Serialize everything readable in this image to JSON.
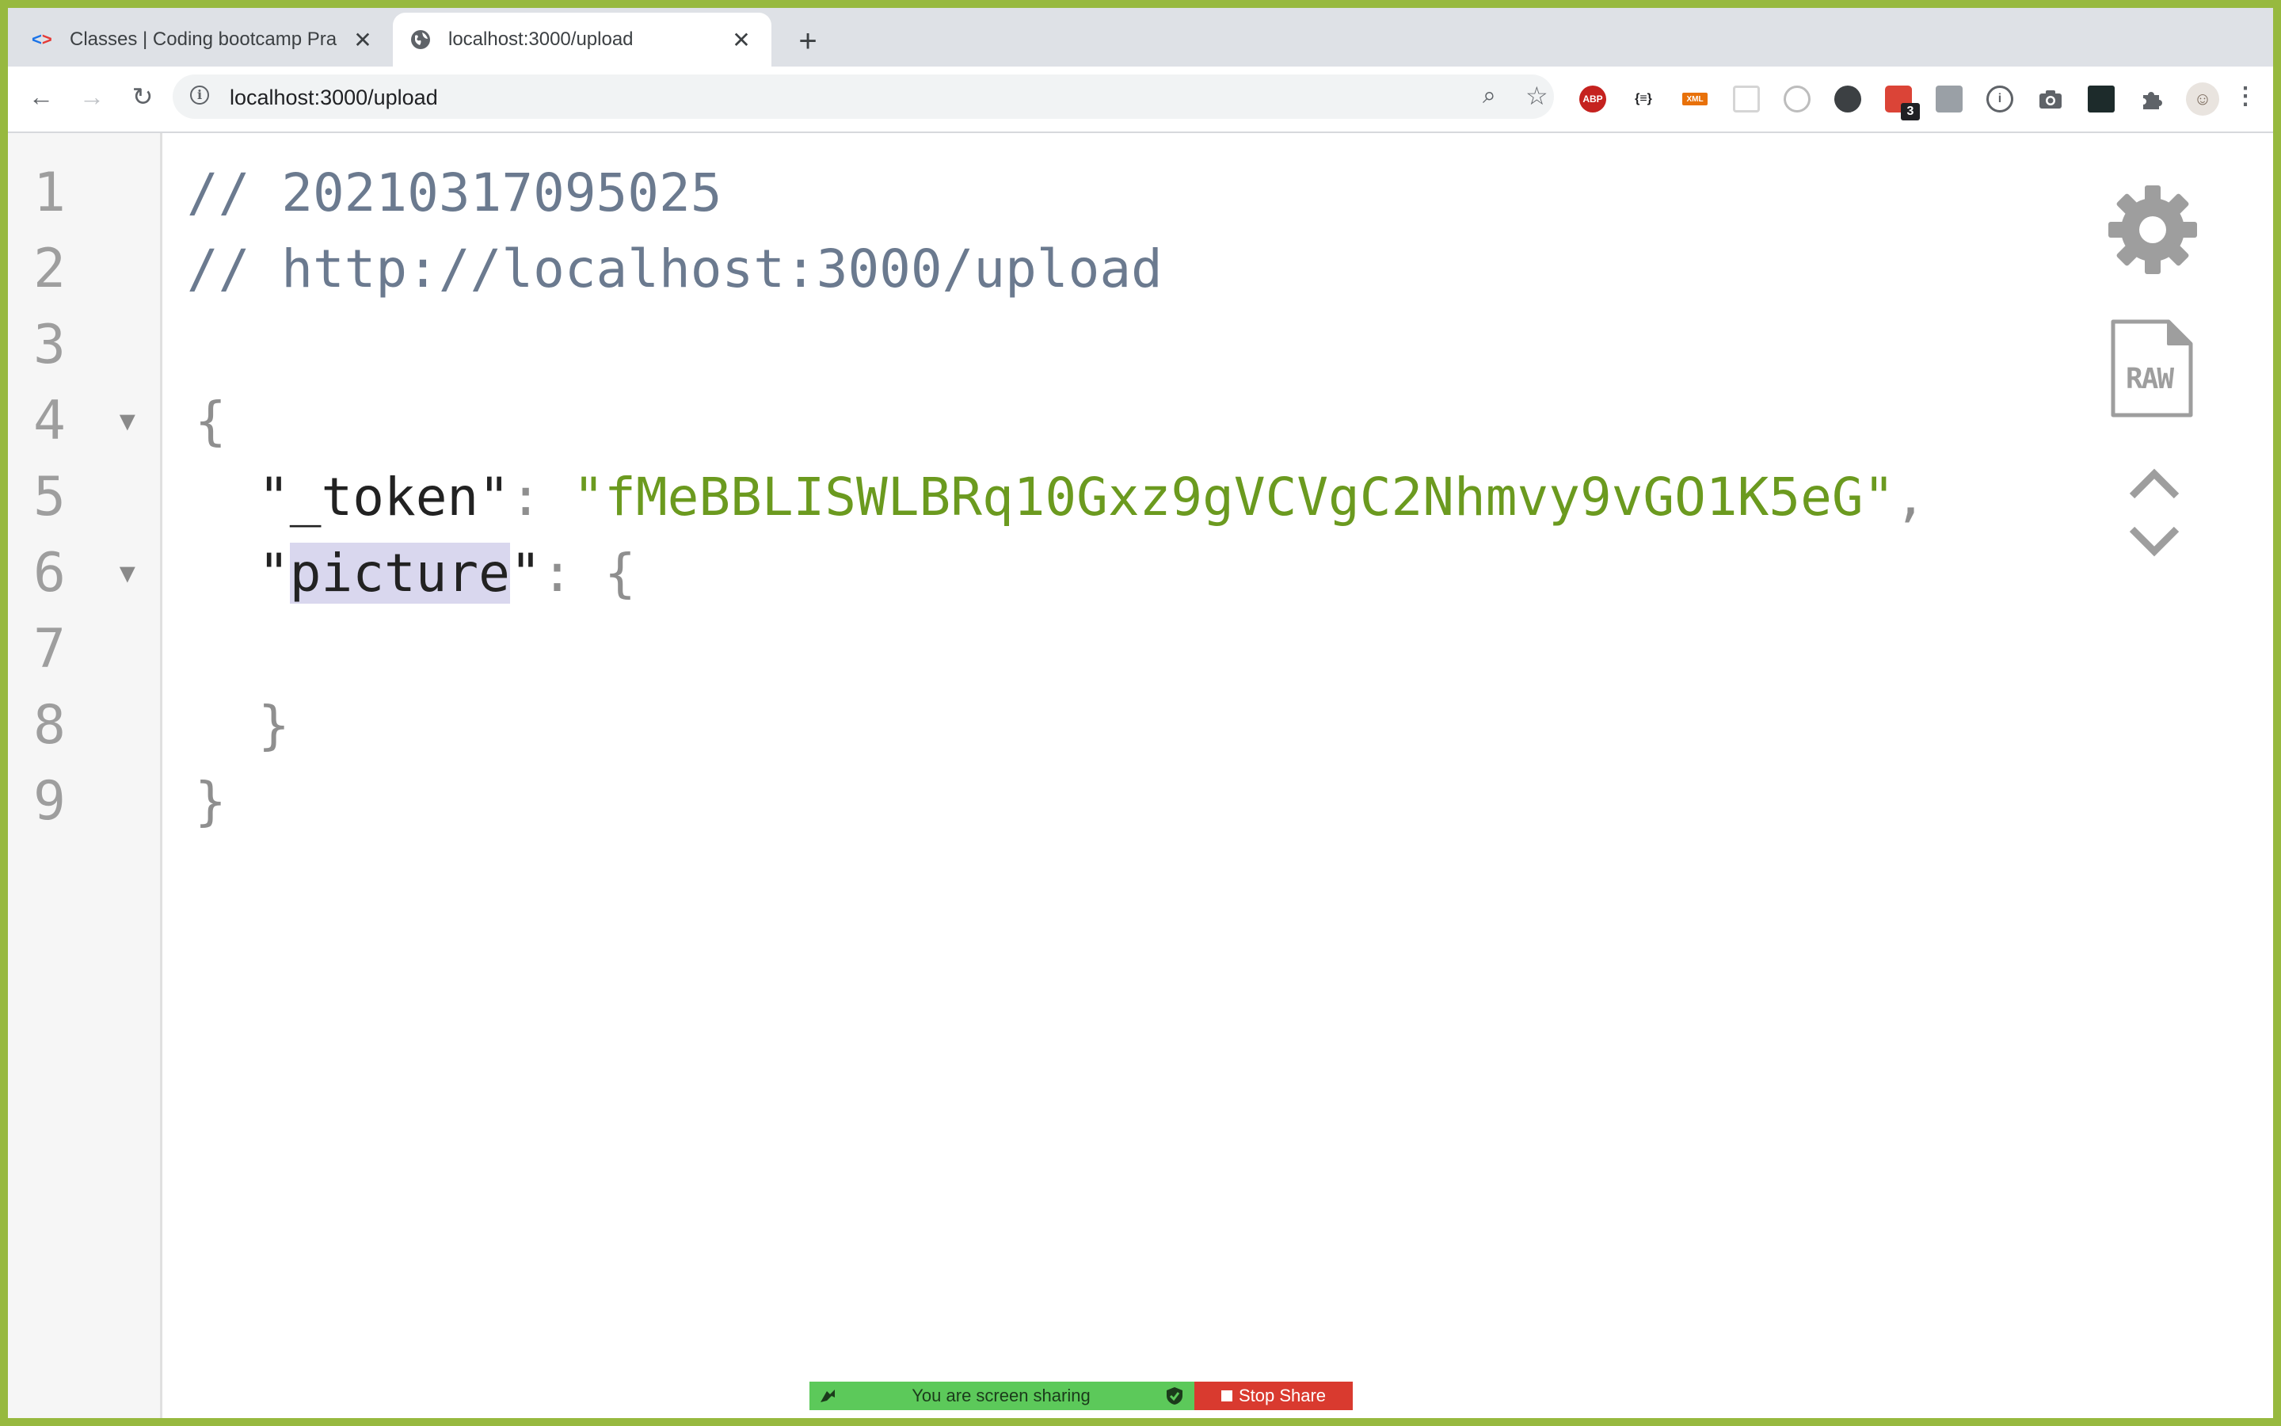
{
  "tabs": [
    {
      "title": "Classes | Coding bootcamp Pra",
      "close": "✕"
    },
    {
      "title": "localhost:3000/upload",
      "close": "✕"
    }
  ],
  "new_tab": "+",
  "toolbar": {
    "back": "←",
    "forward": "→",
    "reload": "↻",
    "url": "localhost:3000/upload",
    "info": "i",
    "zoom": "⌕",
    "star": "☆",
    "extensions": {
      "abp": "ABP",
      "json": "{≡}",
      "xml": "XML",
      "todo_badge": "3",
      "info2": "i",
      "menu": "⋮"
    }
  },
  "viewer": {
    "line_numbers": [
      "1",
      "2",
      "3",
      "4",
      "5",
      "6",
      "7",
      "8",
      "9"
    ],
    "fold_marker": "▼",
    "comment_1": "// 20210317095025",
    "comment_2": "// http://localhost:3000/upload",
    "open_brace": "{",
    "token_key_quote_open": "\"",
    "token_key": "_token",
    "token_key_quote_close": "\"",
    "colon": ": ",
    "token_value": "\"fMeBBLISWLBRq10Gxz9gVCVgC2Nhmvy9vGO1K5eG\"",
    "comma": ",",
    "picture_quote_open": "\"",
    "picture_key": "picture",
    "picture_quote_close": "\"",
    "picture_open": "{",
    "picture_close": "}",
    "close_brace": "}",
    "raw_label": "RAW"
  },
  "screen_share": {
    "message": "You are screen sharing",
    "stop_label": "Stop Share"
  },
  "colors": {
    "frame": "#97b93f",
    "string": "#6b9a1f",
    "comment": "#6b7a8f",
    "highlight": "#d9d7ee",
    "share_green": "#5cc95a",
    "share_red": "#d93a2f"
  }
}
